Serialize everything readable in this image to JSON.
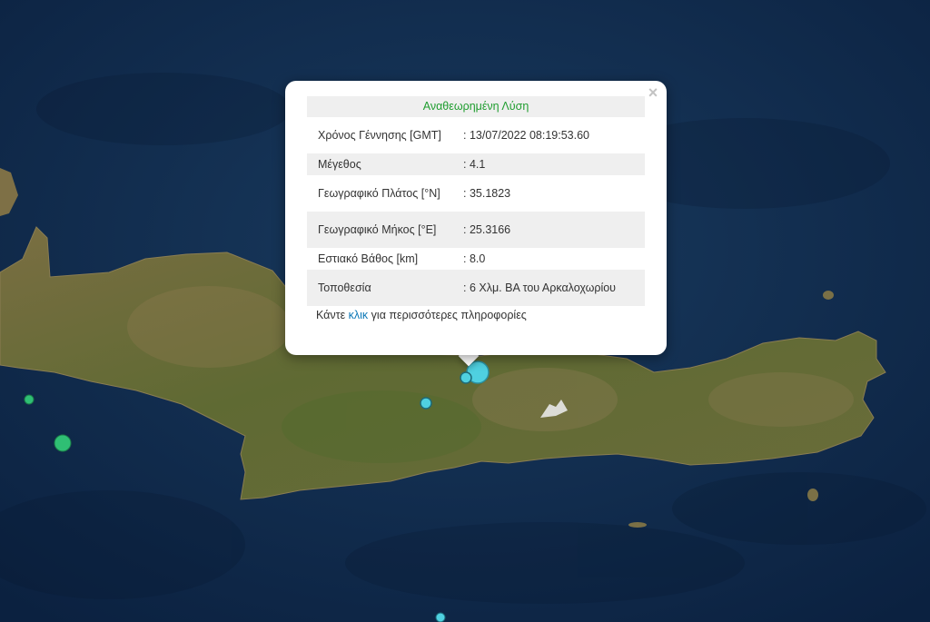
{
  "popup": {
    "title": "Αναθεωρημένη Λύση",
    "rows": [
      {
        "label": "Χρόνος Γέννησης [GMT]",
        "value": ": 13/07/2022 08:19:53.60"
      },
      {
        "label": "Μέγεθος",
        "value": ": 4.1"
      },
      {
        "label": "Γεωγραφικό Πλάτος [°N]",
        "value": ": 35.1823"
      },
      {
        "label": "Γεωγραφικό Μήκος [°E]",
        "value": ": 25.3166"
      },
      {
        "label": "Εστιακό Βάθος [km]",
        "value": ": 8.0"
      },
      {
        "label": "Τοποθεσία",
        "value": ": 6 Χλμ. ΒΑ του Αρκαλοχωρίου"
      }
    ],
    "more_prefix": "Κάντε",
    "more_link": "κλικ",
    "more_suffix": "για περισσότερες πληροφορίες",
    "close_glyph": "×"
  },
  "colors": {
    "sea": "#0f2a4a",
    "land": "#6b6b38",
    "marker_cyan": "#4fd0e0",
    "marker_green": "#2fbf74",
    "title_green": "#1f9d2f",
    "link_blue": "#0b77b7"
  }
}
